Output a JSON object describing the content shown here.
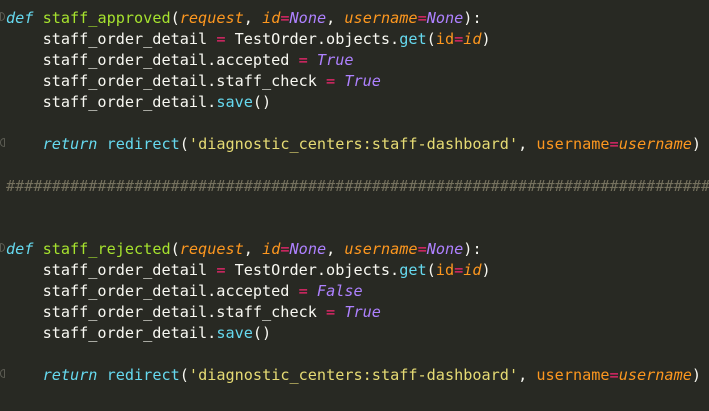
{
  "editor": {
    "theme_colors": {
      "background": "#282923",
      "keyword": "#66d9ef",
      "function_name": "#a6e22e",
      "parameter": "#fd971f",
      "operator": "#f92672",
      "constant": "#ae81ff",
      "string": "#e6db74",
      "text": "#f8f8f2",
      "comment": "#75715e"
    },
    "lines": [
      {
        "tokens": [
          {
            "t": "def",
            "c": "kw"
          },
          {
            "t": " ",
            "c": "plain"
          },
          {
            "t": "staff_approved",
            "c": "fn"
          },
          {
            "t": "(",
            "c": "plain"
          },
          {
            "t": "request",
            "c": "param"
          },
          {
            "t": ", ",
            "c": "plain"
          },
          {
            "t": "id",
            "c": "param"
          },
          {
            "t": "=",
            "c": "op"
          },
          {
            "t": "None",
            "c": "const"
          },
          {
            "t": ", ",
            "c": "plain"
          },
          {
            "t": "username",
            "c": "param"
          },
          {
            "t": "=",
            "c": "op"
          },
          {
            "t": "None",
            "c": "const"
          },
          {
            "t": "):",
            "c": "plain"
          }
        ],
        "fold": "open"
      },
      {
        "tokens": [
          {
            "t": "    staff_order_detail ",
            "c": "plain"
          },
          {
            "t": "=",
            "c": "op"
          },
          {
            "t": " TestOrder.objects.",
            "c": "plain"
          },
          {
            "t": "get",
            "c": "call"
          },
          {
            "t": "(",
            "c": "plain"
          },
          {
            "t": "id",
            "c": "kwarg"
          },
          {
            "t": "=",
            "c": "op"
          },
          {
            "t": "id",
            "c": "kwval"
          },
          {
            "t": ")",
            "c": "plain"
          }
        ]
      },
      {
        "tokens": [
          {
            "t": "    staff_order_detail.accepted ",
            "c": "plain"
          },
          {
            "t": "=",
            "c": "op"
          },
          {
            "t": " ",
            "c": "plain"
          },
          {
            "t": "True",
            "c": "const"
          }
        ]
      },
      {
        "tokens": [
          {
            "t": "    staff_order_detail.staff_check ",
            "c": "plain"
          },
          {
            "t": "=",
            "c": "op"
          },
          {
            "t": " ",
            "c": "plain"
          },
          {
            "t": "True",
            "c": "const"
          }
        ]
      },
      {
        "tokens": [
          {
            "t": "    staff_order_detail.",
            "c": "plain"
          },
          {
            "t": "save",
            "c": "call"
          },
          {
            "t": "()",
            "c": "plain"
          }
        ]
      },
      {
        "tokens": [
          {
            "t": "",
            "c": "plain"
          }
        ]
      },
      {
        "tokens": [
          {
            "t": "    ",
            "c": "plain"
          },
          {
            "t": "return",
            "c": "kw"
          },
          {
            "t": " ",
            "c": "plain"
          },
          {
            "t": "redirect",
            "c": "call"
          },
          {
            "t": "(",
            "c": "plain"
          },
          {
            "t": "'diagnostic_centers:staff-dashboard'",
            "c": "str"
          },
          {
            "t": ", ",
            "c": "plain"
          },
          {
            "t": "username",
            "c": "kwarg"
          },
          {
            "t": "=",
            "c": "op"
          },
          {
            "t": "username",
            "c": "kwval"
          },
          {
            "t": ")",
            "c": "plain"
          }
        ],
        "fold": "end"
      },
      {
        "tokens": [
          {
            "t": "",
            "c": "plain"
          }
        ]
      },
      {
        "tokens": [
          {
            "t": "##############################################################################",
            "c": "comment"
          }
        ]
      },
      {
        "tokens": [
          {
            "t": "",
            "c": "plain"
          }
        ]
      },
      {
        "tokens": [
          {
            "t": "",
            "c": "plain"
          }
        ]
      },
      {
        "tokens": [
          {
            "t": "def",
            "c": "kw"
          },
          {
            "t": " ",
            "c": "plain"
          },
          {
            "t": "staff_rejected",
            "c": "fn"
          },
          {
            "t": "(",
            "c": "plain"
          },
          {
            "t": "request",
            "c": "param"
          },
          {
            "t": ", ",
            "c": "plain"
          },
          {
            "t": "id",
            "c": "param"
          },
          {
            "t": "=",
            "c": "op"
          },
          {
            "t": "None",
            "c": "const"
          },
          {
            "t": ", ",
            "c": "plain"
          },
          {
            "t": "username",
            "c": "param"
          },
          {
            "t": "=",
            "c": "op"
          },
          {
            "t": "None",
            "c": "const"
          },
          {
            "t": "):",
            "c": "plain"
          }
        ],
        "fold": "open"
      },
      {
        "tokens": [
          {
            "t": "    staff_order_detail ",
            "c": "plain"
          },
          {
            "t": "=",
            "c": "op"
          },
          {
            "t": " TestOrder.objects.",
            "c": "plain"
          },
          {
            "t": "get",
            "c": "call"
          },
          {
            "t": "(",
            "c": "plain"
          },
          {
            "t": "id",
            "c": "kwarg"
          },
          {
            "t": "=",
            "c": "op"
          },
          {
            "t": "id",
            "c": "kwval"
          },
          {
            "t": ")",
            "c": "plain"
          }
        ]
      },
      {
        "tokens": [
          {
            "t": "    staff_order_detail.accepted ",
            "c": "plain"
          },
          {
            "t": "=",
            "c": "op"
          },
          {
            "t": " ",
            "c": "plain"
          },
          {
            "t": "False",
            "c": "const"
          }
        ]
      },
      {
        "tokens": [
          {
            "t": "    staff_order_detail.staff_check ",
            "c": "plain"
          },
          {
            "t": "=",
            "c": "op"
          },
          {
            "t": " ",
            "c": "plain"
          },
          {
            "t": "True",
            "c": "const"
          }
        ]
      },
      {
        "tokens": [
          {
            "t": "    staff_order_detail.",
            "c": "plain"
          },
          {
            "t": "save",
            "c": "call"
          },
          {
            "t": "()",
            "c": "plain"
          }
        ]
      },
      {
        "tokens": [
          {
            "t": "",
            "c": "plain"
          }
        ]
      },
      {
        "tokens": [
          {
            "t": "    ",
            "c": "plain"
          },
          {
            "t": "return",
            "c": "kw"
          },
          {
            "t": " ",
            "c": "plain"
          },
          {
            "t": "redirect",
            "c": "call"
          },
          {
            "t": "(",
            "c": "plain"
          },
          {
            "t": "'diagnostic_centers:staff-dashboard'",
            "c": "str"
          },
          {
            "t": ", ",
            "c": "plain"
          },
          {
            "t": "username",
            "c": "kwarg"
          },
          {
            "t": "=",
            "c": "op"
          },
          {
            "t": "username",
            "c": "kwval"
          },
          {
            "t": ")",
            "c": "plain"
          }
        ],
        "fold": "end"
      }
    ]
  }
}
